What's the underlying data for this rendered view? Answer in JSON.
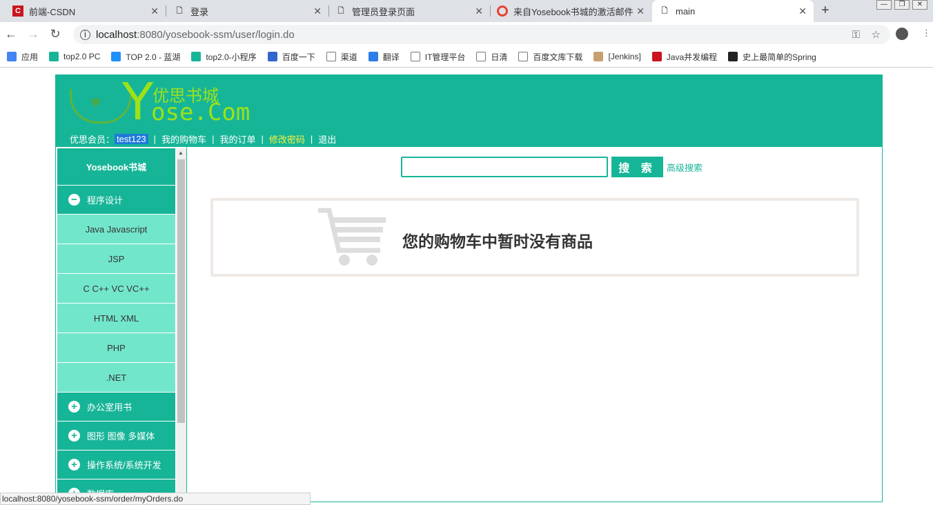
{
  "browser": {
    "tabs": [
      {
        "title": "前端-CSDN",
        "icon": "C"
      },
      {
        "title": "登录"
      },
      {
        "title": "管理员登录页面"
      },
      {
        "title": "来自Yosebook书城的激活邮件"
      },
      {
        "title": "main"
      }
    ],
    "url_host": "localhost",
    "url_rest": ":8080/yosebook-ssm/user/login.do",
    "bookmarks": [
      "应用",
      "top2.0 PC",
      "TOP 2.0 - 蓝湖",
      "top2.0-小程序",
      "百度一下",
      "渠道",
      "翻译",
      "IT管理平台",
      "日清",
      "百度文库下载",
      "[Jenkins]",
      "Java并发编程",
      "史上最简单的Spring"
    ],
    "status_url": "localhost:8080/yosebook-ssm/order/myOrders.do"
  },
  "header": {
    "logo_cn": "优思书城",
    "logo_y": "Y",
    "logo_en": "ose.Com",
    "member_label": "优思会员：",
    "username": "test123",
    "cart": "我的购物车",
    "orders": "我的订单",
    "change_password": "修改密码",
    "logout": "退出",
    "pipe": "|"
  },
  "sidebar": {
    "title": "Yosebook书城",
    "expanded": {
      "label": "程序设计",
      "sub": [
        "Java Javascript",
        "JSP",
        "C C++ VC VC++",
        "HTML XML",
        "PHP",
        ".NET"
      ]
    },
    "categories": [
      "办公室用书",
      "图形 图像 多媒体",
      "操作系统/系统开发",
      "数据库"
    ]
  },
  "search": {
    "button": "搜 索",
    "advanced": "高级搜索",
    "value": ""
  },
  "cart": {
    "message": "您的购物车中暂时没有商品"
  },
  "colors": {
    "primary": "#17b598",
    "sub": "#72e6cb"
  }
}
